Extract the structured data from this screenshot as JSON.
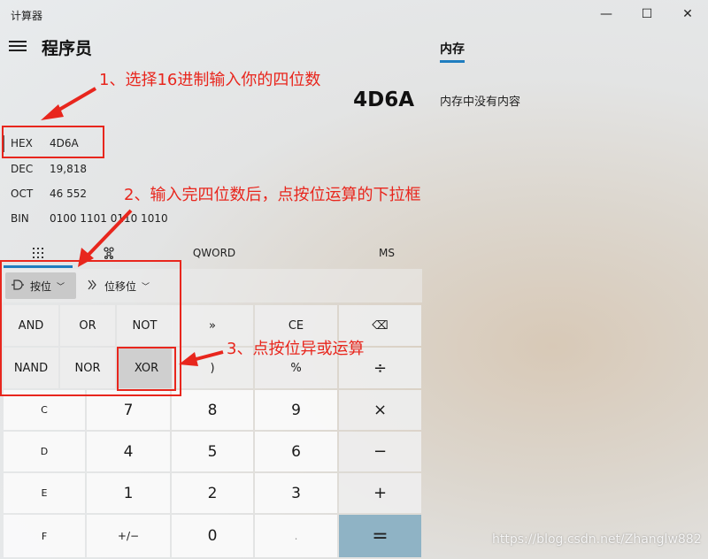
{
  "window": {
    "title": "计算器",
    "controls": {
      "minimize": "—",
      "maximize": "☐",
      "close": "✕"
    }
  },
  "header": {
    "mode": "程序员",
    "menu_icon": "hamburger-menu-icon"
  },
  "memory": {
    "tab_label": "内存",
    "empty_message": "内存中没有内容"
  },
  "display": {
    "value": "4D6A",
    "radix": [
      {
        "name": "HEX",
        "value": "4D6A"
      },
      {
        "name": "DEC",
        "value": "19,818"
      },
      {
        "name": "OCT",
        "value": "46 552"
      },
      {
        "name": "BIN",
        "value": "0100 1101 0110 1010"
      }
    ]
  },
  "toolbar": {
    "keypad_icon": "full-keypad-icon",
    "bitflip_icon": "bit-toggling-keypad-icon",
    "word_size": "QWORD",
    "ms": "MS"
  },
  "operators": {
    "bitwise": {
      "label": "按位",
      "icon": "logic-gate-icon"
    },
    "bitshift": {
      "label": "位移位",
      "icon": "bit-shift-icon"
    }
  },
  "keys": {
    "row1": [
      "AND",
      "OR",
      "NOT",
      "»",
      "CE",
      "⌫"
    ],
    "row2": [
      "NAND",
      "NOR",
      "XOR",
      ")",
      "%",
      "÷"
    ],
    "row3": [
      "C",
      "7",
      "8",
      "9",
      "×"
    ],
    "row4": [
      "D",
      "4",
      "5",
      "6",
      "−"
    ],
    "row5": [
      "E",
      "1",
      "2",
      "3",
      "+"
    ],
    "row6": [
      "F",
      "+/−",
      "0",
      ".",
      "="
    ]
  },
  "annotations": {
    "step1": "1、选择16进制输入你的四位数",
    "step2": "2、输入完四位数后，点按位运算的下拉框",
    "step3": "3、点按位异或运算"
  },
  "colors": {
    "accent": "#1f7dbf",
    "annotation": "#e8261d",
    "equals_key": "#8fb3c5"
  },
  "watermark": "https://blog.csdn.net/Zhanglw882"
}
